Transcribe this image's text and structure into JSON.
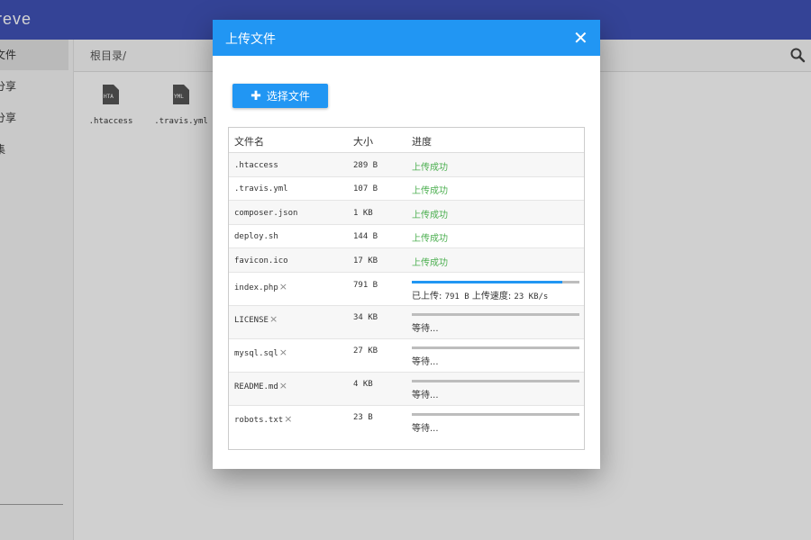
{
  "app": {
    "title": "reve",
    "sidebar": [
      {
        "label": "文件",
        "active": true
      },
      {
        "label": "分享",
        "active": false
      },
      {
        "label": "分享",
        "active": false
      },
      {
        "label": "集",
        "active": false
      }
    ],
    "breadcrumb": "根目录/",
    "files": [
      {
        "name": ".htaccess",
        "icon": "file-icon",
        "glyph": "HTA"
      },
      {
        "name": ".travis.yml",
        "icon": "file-icon",
        "glyph": "YML"
      }
    ]
  },
  "dialog": {
    "title": "上传文件",
    "close_icon": "close-icon",
    "select_button": "选择文件",
    "columns": {
      "name": "文件名",
      "size": "大小",
      "progress": "进度"
    },
    "rows": [
      {
        "name": ".htaccess",
        "size": "289 B",
        "status": "上传成功"
      },
      {
        "name": ".travis.yml",
        "size": "107 B",
        "status": "上传成功"
      },
      {
        "name": "composer.json",
        "size": "1 KB",
        "status": "上传成功"
      },
      {
        "name": "deploy.sh",
        "size": "144 B",
        "status": "上传成功"
      },
      {
        "name": "favicon.ico",
        "size": "17 KB",
        "status": "上传成功"
      },
      {
        "name": "index.php",
        "size": "791 B",
        "progress": 0.9,
        "uploaded_label": "已上传:",
        "uploaded": "791 B",
        "speed_label": "上传速度:",
        "speed": "23 KB/s"
      },
      {
        "name": "LICENSE",
        "size": "34 KB",
        "progress": 0,
        "waiting": "等待..."
      },
      {
        "name": "mysql.sql",
        "size": "27 KB",
        "progress": 0,
        "waiting": "等待..."
      },
      {
        "name": "README.md",
        "size": "4 KB",
        "progress": 0,
        "waiting": "等待..."
      },
      {
        "name": "robots.txt",
        "size": "23 B",
        "progress": 0,
        "waiting": "等待..."
      }
    ],
    "cancel_glyph": "×"
  },
  "colors": {
    "app_bar": "#3f51b5",
    "accent": "#2196f3",
    "success": "#4caf50"
  }
}
